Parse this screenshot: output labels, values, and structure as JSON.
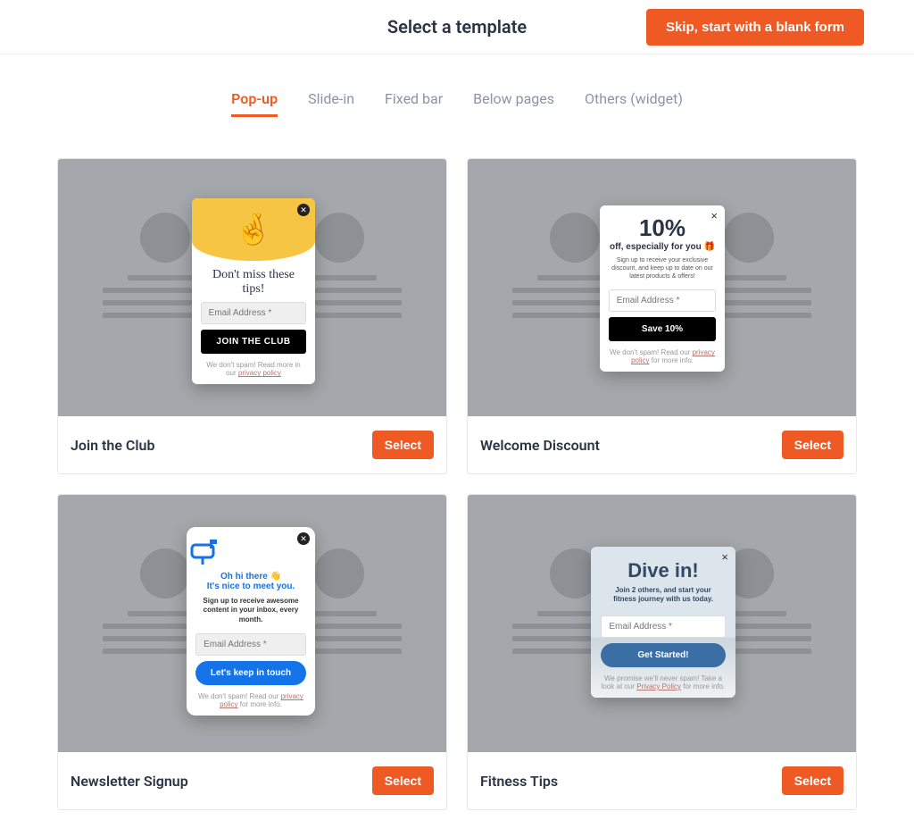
{
  "header": {
    "title": "Select a template",
    "skip_label": "Skip, start with a blank form"
  },
  "tabs": [
    {
      "label": "Pop-up",
      "active": true
    },
    {
      "label": "Slide-in",
      "active": false
    },
    {
      "label": "Fixed bar",
      "active": false
    },
    {
      "label": "Below pages",
      "active": false
    },
    {
      "label": "Others (widget)",
      "active": false
    }
  ],
  "templates": [
    {
      "name": "Join the Club",
      "select_label": "Select",
      "popup": {
        "icon": "🤞",
        "heading": "Don't miss these tips!",
        "placeholder": "Email Address *",
        "cta": "JOIN THE CLUB",
        "fineprint_pre": "We don't spam! Read more in our ",
        "fineprint_link": "privacy policy"
      }
    },
    {
      "name": "Welcome Discount",
      "select_label": "Select",
      "popup": {
        "headline": "10%",
        "subline": "off, especially for you",
        "sub_icon": "🎁",
        "desc": "Sign up to receive your exclusive discount, and keep up to date on our latest products & offers!",
        "placeholder": "Email Address *",
        "cta": "Save 10%",
        "fineprint_pre": "We don't spam! Read our ",
        "fineprint_link": "privacy policy",
        "fineprint_post": " for more info."
      }
    },
    {
      "name": "Newsletter Signup",
      "select_label": "Select",
      "popup": {
        "hi": "Oh hi there",
        "hi_icon": "👋",
        "nice": "It's nice to meet you.",
        "desc": "Sign up to receive awesome content in your inbox, every month.",
        "placeholder": "Email Address *",
        "cta": "Let's keep in touch",
        "fineprint_pre": "We don't spam! Read our ",
        "fineprint_link": "privacy policy",
        "fineprint_post": " for more info."
      }
    },
    {
      "name": "Fitness Tips",
      "select_label": "Select",
      "popup": {
        "headline": "Dive in!",
        "desc": "Join 2 others, and start your fitness journey with us today.",
        "placeholder": "Email Address *",
        "cta": "Get Started!",
        "fineprint_pre": "We promise we'll never spam! Take a look at our ",
        "fineprint_link": "Privacy Policy",
        "fineprint_post": " for more info."
      }
    }
  ]
}
